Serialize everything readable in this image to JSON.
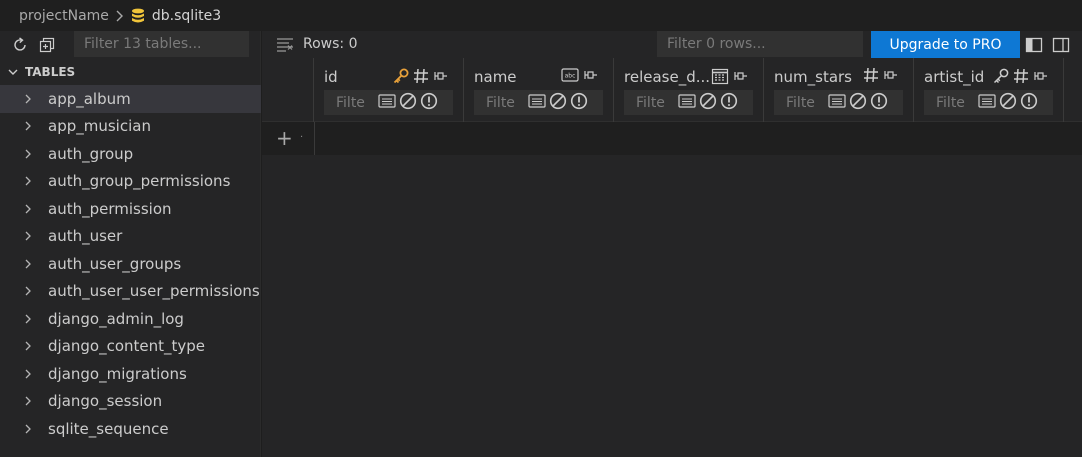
{
  "breadcrumb": {
    "project": "projectName",
    "file": "db.sqlite3"
  },
  "left_panel": {
    "filter_placeholder": "Filter 13 tables...",
    "section_title": "TABLES",
    "tables": [
      "app_album",
      "app_musician",
      "auth_group",
      "auth_group_permissions",
      "auth_permission",
      "auth_user",
      "auth_user_groups",
      "auth_user_user_permissions",
      "django_admin_log",
      "django_content_type",
      "django_migrations",
      "django_session",
      "sqlite_sequence"
    ],
    "selected_table": "app_album"
  },
  "toolbar": {
    "rows_label": "Rows: 0",
    "filter_rows_placeholder": "Filter 0 rows...",
    "upgrade_label": "Upgrade to PRO"
  },
  "columns": [
    {
      "name": "id",
      "type_icons": [
        "key-icon",
        "hash-icon"
      ],
      "filter_placeholder": "Filte"
    },
    {
      "name": "name",
      "type_icons": [
        "abc-icon"
      ],
      "filter_placeholder": "Filte"
    },
    {
      "name": "release_d...",
      "type_icons": [
        "calendar-icon"
      ],
      "filter_placeholder": "Filte"
    },
    {
      "name": "num_stars",
      "type_icons": [
        "hash-icon"
      ],
      "filter_placeholder": "Filte"
    },
    {
      "name": "artist_id",
      "type_icons": [
        "key-outline-icon",
        "hash-icon"
      ],
      "filter_placeholder": "Filte"
    }
  ],
  "colors": {
    "accent": "#0e78d4",
    "key": "#e8a13a",
    "background": "#1e1e1e",
    "panel": "#252526"
  }
}
